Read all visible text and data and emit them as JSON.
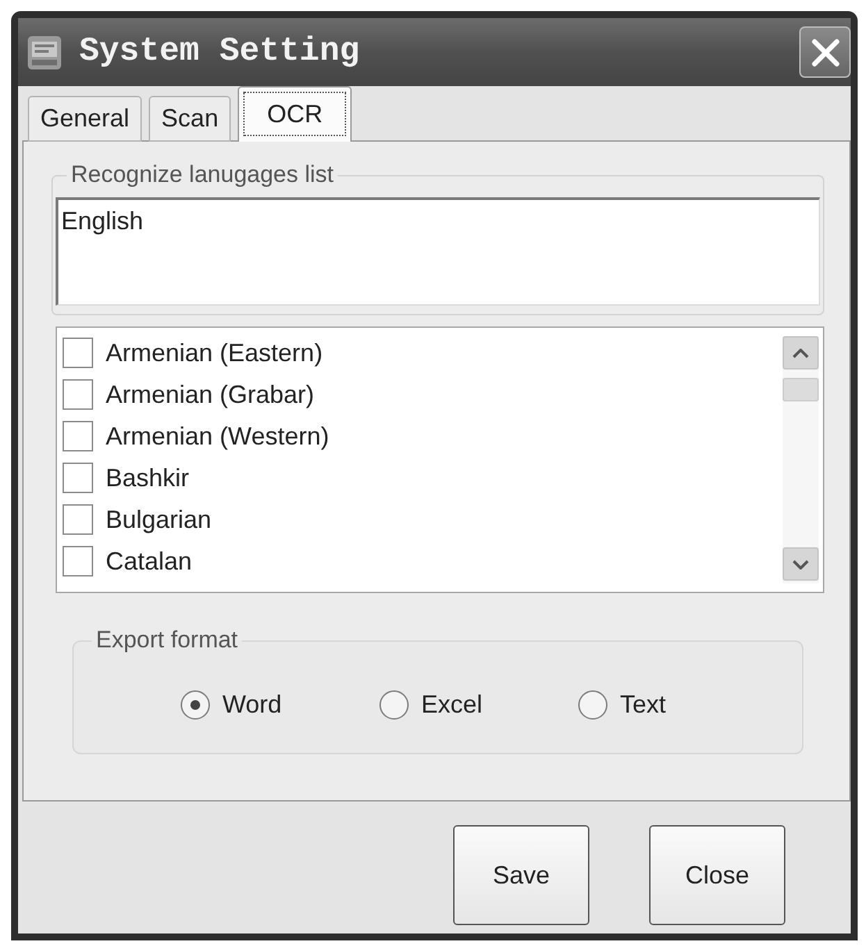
{
  "window": {
    "title": "System Setting"
  },
  "tabs": [
    {
      "label": "General",
      "selected": false
    },
    {
      "label": "Scan",
      "selected": false
    },
    {
      "label": "OCR",
      "selected": true
    }
  ],
  "languages": {
    "label": "Recognize lanugages list",
    "value": "English",
    "items": [
      {
        "label": "Armenian (Eastern)",
        "checked": false
      },
      {
        "label": "Armenian (Grabar)",
        "checked": false
      },
      {
        "label": "Armenian (Western)",
        "checked": false
      },
      {
        "label": "Bashkir",
        "checked": false
      },
      {
        "label": "Bulgarian",
        "checked": false
      },
      {
        "label": "Catalan",
        "checked": false
      }
    ]
  },
  "export_format": {
    "label": "Export format",
    "options": [
      {
        "label": "Word",
        "selected": true
      },
      {
        "label": "Excel",
        "selected": false
      },
      {
        "label": "Text",
        "selected": false
      }
    ]
  },
  "buttons": [
    {
      "label": "Save"
    },
    {
      "label": "Close"
    }
  ]
}
